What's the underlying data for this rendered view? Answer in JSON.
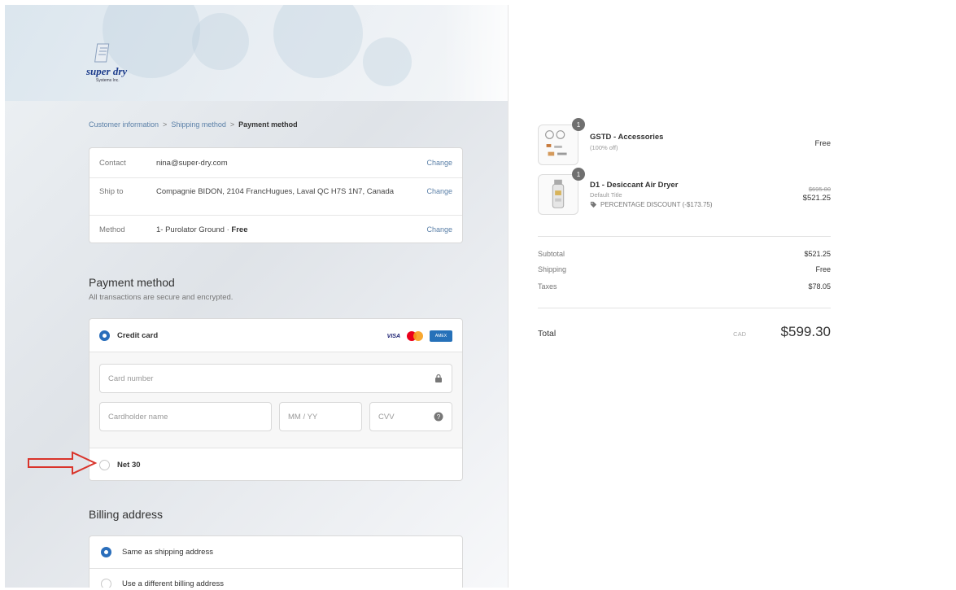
{
  "brand": {
    "logo_word": "super dry",
    "logo_sub": "Systems Inc."
  },
  "breadcrumb": {
    "step1": "Customer information",
    "sep1": ">",
    "step2": "Shipping method",
    "sep2": ">",
    "step3": "Payment method"
  },
  "review": {
    "contact": {
      "label": "Contact",
      "value": "nina@super-dry.com",
      "change": "Change"
    },
    "ship_to": {
      "label": "Ship to",
      "value": "Compagnie BIDON, 2104 FrancHugues, Laval QC H7S 1N7, Canada",
      "change": "Change"
    },
    "method": {
      "label": "Method",
      "value_prefix": "1- Purolator Ground · ",
      "value_bold": "Free",
      "change": "Change"
    }
  },
  "payment": {
    "title": "Payment method",
    "subtitle": "All transactions are secure and encrypted.",
    "credit_card_label": "Credit card",
    "card_number_placeholder": "Card number",
    "cardholder_placeholder": "Cardholder name",
    "expiry_placeholder": "MM / YY",
    "cvv_placeholder": "CVV",
    "net30_label": "Net 30",
    "visa_text": "VISA",
    "amex_text": "AMEX"
  },
  "billing": {
    "title": "Billing address",
    "same_label": "Same as shipping address",
    "different_label": "Use a different billing address"
  },
  "order": {
    "items": [
      {
        "qty": "1",
        "name": "GSTD - Accessories",
        "sub": "(100% off)",
        "price": "Free"
      },
      {
        "qty": "1",
        "name": "D1 - Desiccant Air Dryer",
        "sub": "Default Title",
        "discount": "PERCENTAGE DISCOUNT (-$173.75)",
        "original_price": "$695.00",
        "price": "$521.25"
      }
    ],
    "subtotal_label": "Subtotal",
    "subtotal": "$521.25",
    "shipping_label": "Shipping",
    "shipping": "Free",
    "taxes_label": "Taxes",
    "taxes": "$78.05",
    "total_label": "Total",
    "currency": "CAD",
    "total": "$599.30"
  },
  "colors": {
    "accent": "#2a6ebb",
    "link": "#5b80a8",
    "annotation_arrow": "#d9342b"
  }
}
